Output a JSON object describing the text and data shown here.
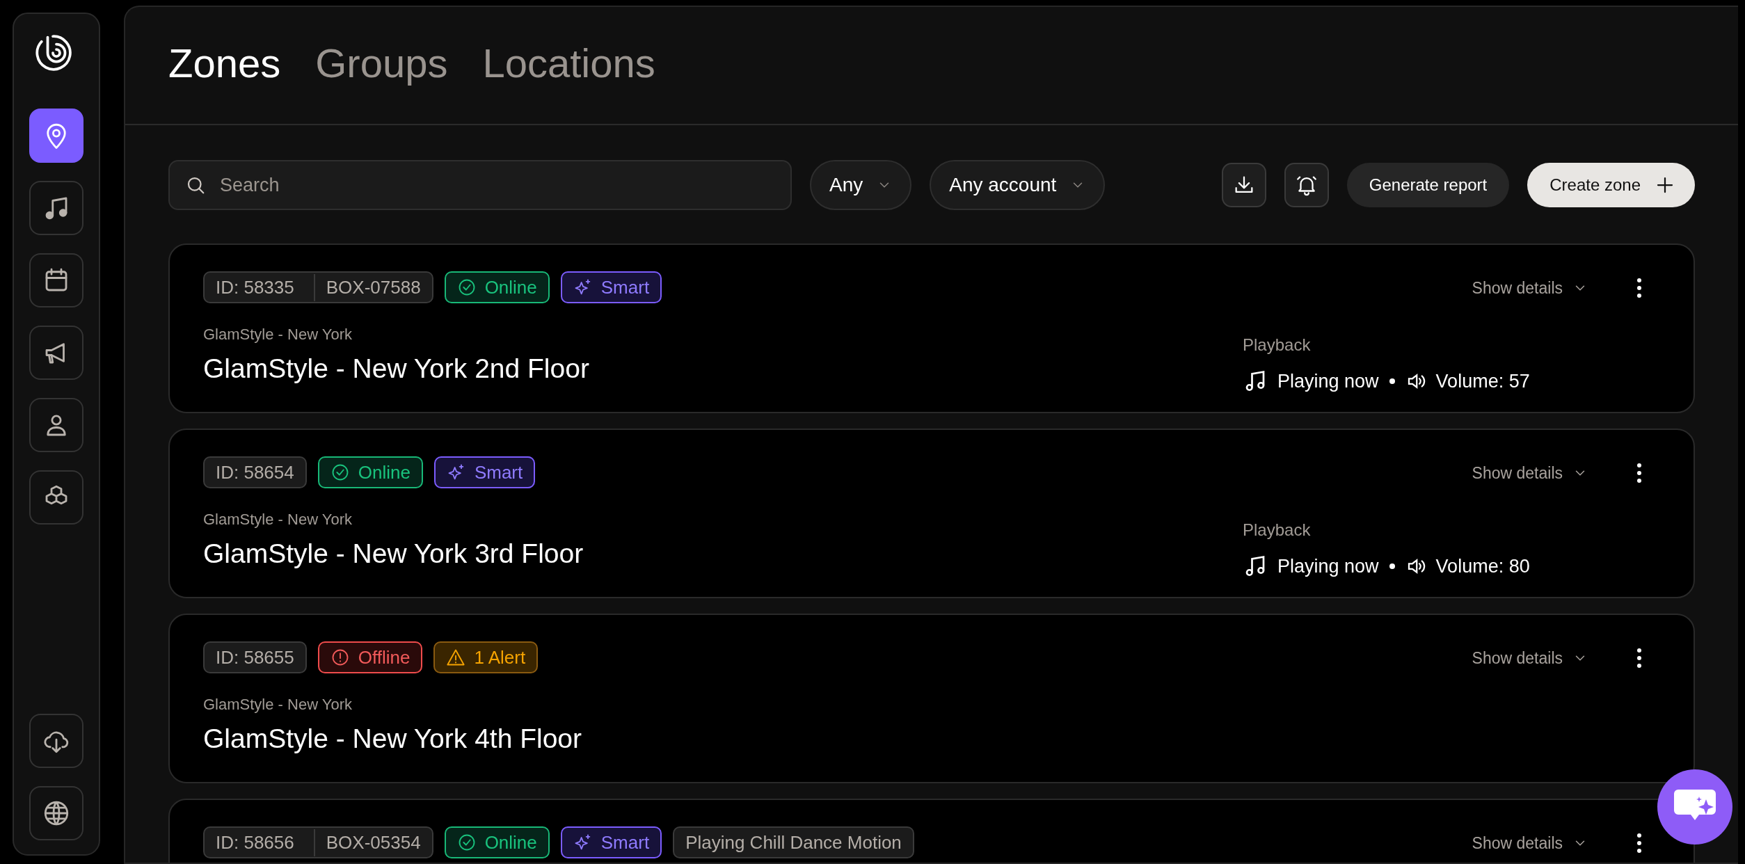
{
  "sidebar": {
    "top_items": [
      {
        "selected": true
      },
      {
        "selected": false
      },
      {
        "selected": false
      },
      {
        "selected": false
      },
      {
        "selected": false
      },
      {
        "selected": false
      }
    ]
  },
  "tabs": [
    {
      "label": "Zones",
      "selected": true
    },
    {
      "label": "Groups",
      "selected": false
    },
    {
      "label": "Locations",
      "selected": false
    }
  ],
  "toolbar": {
    "search": {
      "placeholder": "Search"
    },
    "filters": [
      "Any",
      "Any account"
    ],
    "report_button": "Generate report",
    "create_button": "Create zone"
  },
  "zones": [
    {
      "badges": [
        {
          "kind": "id",
          "parts": [
            "ID: 58335",
            "BOX-07588"
          ]
        },
        {
          "kind": "online",
          "text": "Online"
        },
        {
          "kind": "smart",
          "text": "Smart"
        }
      ],
      "location": "GlamStyle - New York",
      "name": "GlamStyle - New York 2nd Floor",
      "details": "Show details",
      "playback": {
        "label": "Playback",
        "status": "Playing now",
        "volume": "Volume: 57"
      }
    },
    {
      "badges": [
        {
          "kind": "id",
          "parts": [
            "ID: 58654"
          ]
        },
        {
          "kind": "online",
          "text": "Online"
        },
        {
          "kind": "smart",
          "text": "Smart"
        }
      ],
      "location": "GlamStyle - New York",
      "name": "GlamStyle - New York 3rd Floor",
      "details": "Show details",
      "playback": {
        "label": "Playback",
        "status": "Playing now",
        "volume": "Volume: 80"
      }
    },
    {
      "badges": [
        {
          "kind": "id",
          "parts": [
            "ID: 58655"
          ]
        },
        {
          "kind": "offline",
          "text": "Offline"
        },
        {
          "kind": "alert",
          "text": "1 Alert"
        }
      ],
      "location": "GlamStyle - New York",
      "name": "GlamStyle - New York 4th Floor",
      "details": "Show details"
    },
    {
      "badges": [
        {
          "kind": "id",
          "parts": [
            "ID: 58656",
            "BOX-05354"
          ]
        },
        {
          "kind": "online",
          "text": "Online"
        },
        {
          "kind": "smart",
          "text": "Smart"
        },
        {
          "kind": "plain",
          "text": "Playing Chill Dance Motion"
        }
      ],
      "details": "Show details"
    }
  ]
}
